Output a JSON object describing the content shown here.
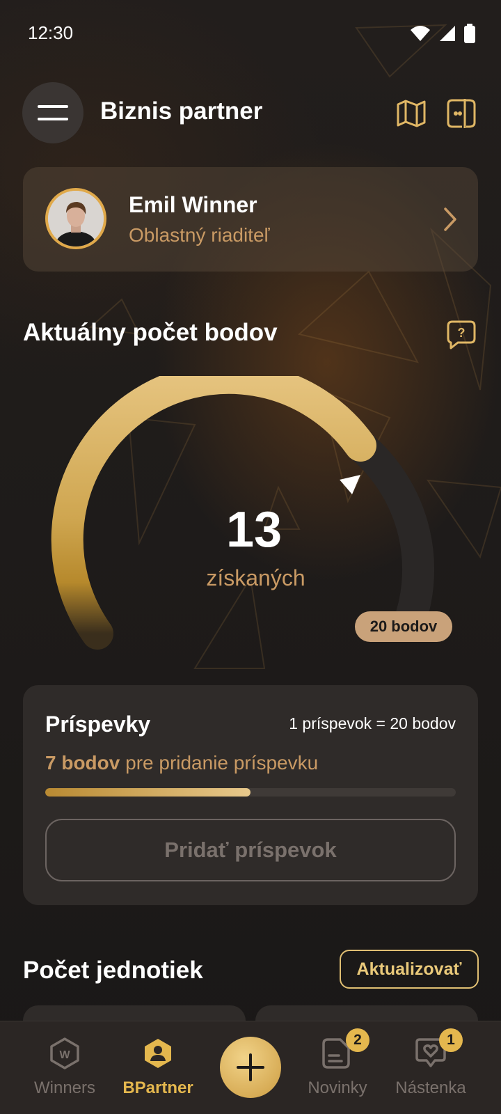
{
  "status_bar": {
    "time": "12:30"
  },
  "header": {
    "title": "Biznis partner"
  },
  "profile": {
    "name": "Emil Winner",
    "role": "Oblastný riaditeľ"
  },
  "points": {
    "title": "Aktuálny počet bodov",
    "value": "13",
    "caption": "získaných",
    "goal_label": "20 bodov",
    "current": 13,
    "goal": 20
  },
  "posts": {
    "title": "Príspevky",
    "rate": "1 príspevok = 20 bodov",
    "note_bold": "7 bodov",
    "note_rest": " pre pridanie príspevku",
    "progress_fraction": 0.5,
    "button_label": "Pridať príspevok"
  },
  "units": {
    "title": "Počet jednotiek",
    "update_label": "Aktualizovať"
  },
  "nav": {
    "items": [
      {
        "label": "Winners",
        "icon": "winners-hex-icon"
      },
      {
        "label": "BPartner",
        "icon": "bpartner-hex-icon",
        "active": true
      },
      {
        "label": "Novinky",
        "icon": "news-icon",
        "badge": "2"
      },
      {
        "label": "Nástenka",
        "icon": "heart-chat-icon",
        "badge": "1"
      }
    ],
    "fab_icon": "plus-icon"
  },
  "colors": {
    "accent": "#e4b74e",
    "accent_muted": "#c99a64",
    "background": "#1c1a19"
  }
}
